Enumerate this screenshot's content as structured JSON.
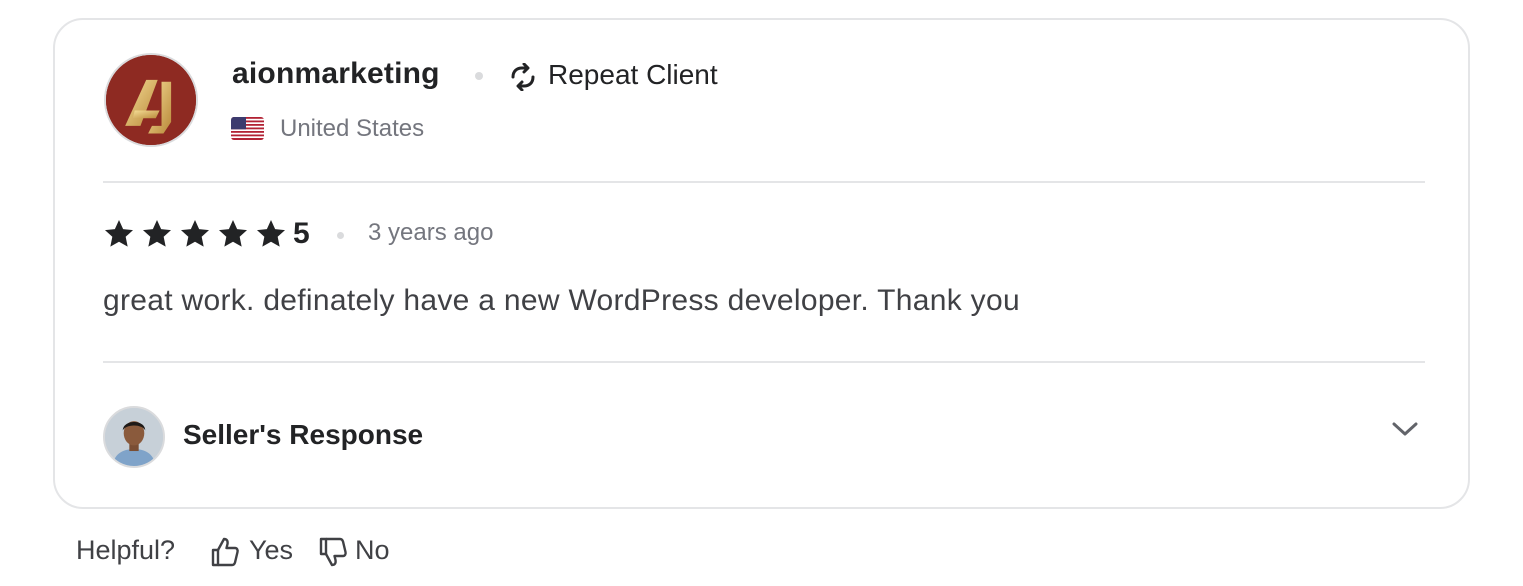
{
  "review": {
    "username": "aionmarketing",
    "badge": {
      "label": "Repeat Client",
      "icon": "repeat-icon"
    },
    "country": {
      "name": "United States",
      "flag": "us-flag-icon"
    },
    "rating": {
      "stars": 5,
      "value": "5"
    },
    "time_ago": "3 years ago",
    "text": "great work. definately have a new WordPress developer. Thank you"
  },
  "seller_response": {
    "label": "Seller's Response",
    "icon": "chevron-down-icon"
  },
  "feedback": {
    "prompt": "Helpful?",
    "yes_label": "Yes",
    "no_label": "No"
  },
  "colors": {
    "border": "#e4e5e7",
    "text_primary": "#222325",
    "text_secondary": "#74767e",
    "avatar_bg": "#8e2a22",
    "avatar_gold": "#e6c472"
  }
}
